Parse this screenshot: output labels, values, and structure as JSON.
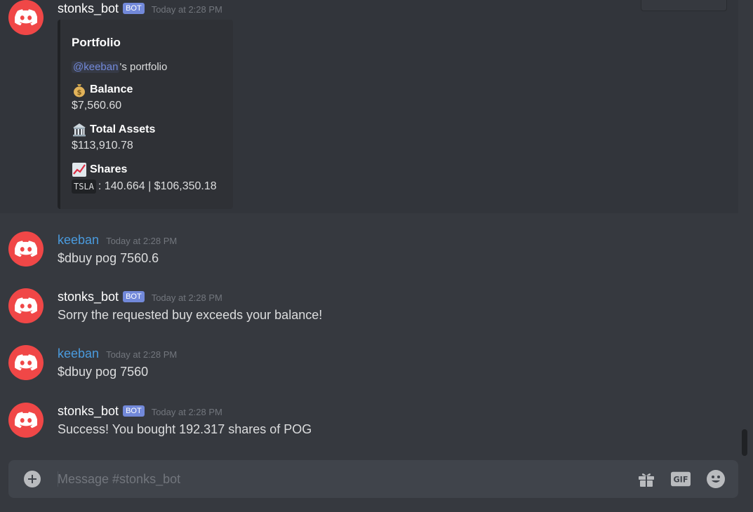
{
  "channel": "stonks_bot",
  "composer": {
    "placeholder": "Message #stonks_bot"
  },
  "messages": [
    {
      "author": "stonks_bot",
      "bot_tag": "BOT",
      "time": "Today at 2:28 PM",
      "embed": {
        "title": "Portfolio",
        "mention": "@keeban",
        "desc_suffix": "'s portfolio",
        "fields": [
          {
            "emoji": "money-bag-icon",
            "name": "Balance",
            "value": "$7,560.60"
          },
          {
            "emoji": "bank-icon",
            "name": "Total Assets",
            "value": "$113,910.78"
          },
          {
            "emoji": "chart-increasing-icon",
            "name": "Shares",
            "code": "TSLA",
            "value": ": 140.664 | $106,350.18"
          }
        ]
      }
    },
    {
      "author": "keeban",
      "time": "Today at 2:28 PM",
      "text": "$dbuy pog 7560.6"
    },
    {
      "author": "stonks_bot",
      "bot_tag": "BOT",
      "time": "Today at 2:28 PM",
      "text": "Sorry the requested buy exceeds your balance!"
    },
    {
      "author": "keeban",
      "time": "Today at 2:28 PM",
      "text": "$dbuy pog 7560"
    },
    {
      "author": "stonks_bot",
      "bot_tag": "BOT",
      "time": "Today at 2:28 PM",
      "text": "Success! You bought 192.317 shares of POG"
    }
  ],
  "colors": {
    "background": "#36393f",
    "avatar": "#f04747",
    "bot_tag": "#7289da",
    "user_name": "#4a9bde"
  }
}
